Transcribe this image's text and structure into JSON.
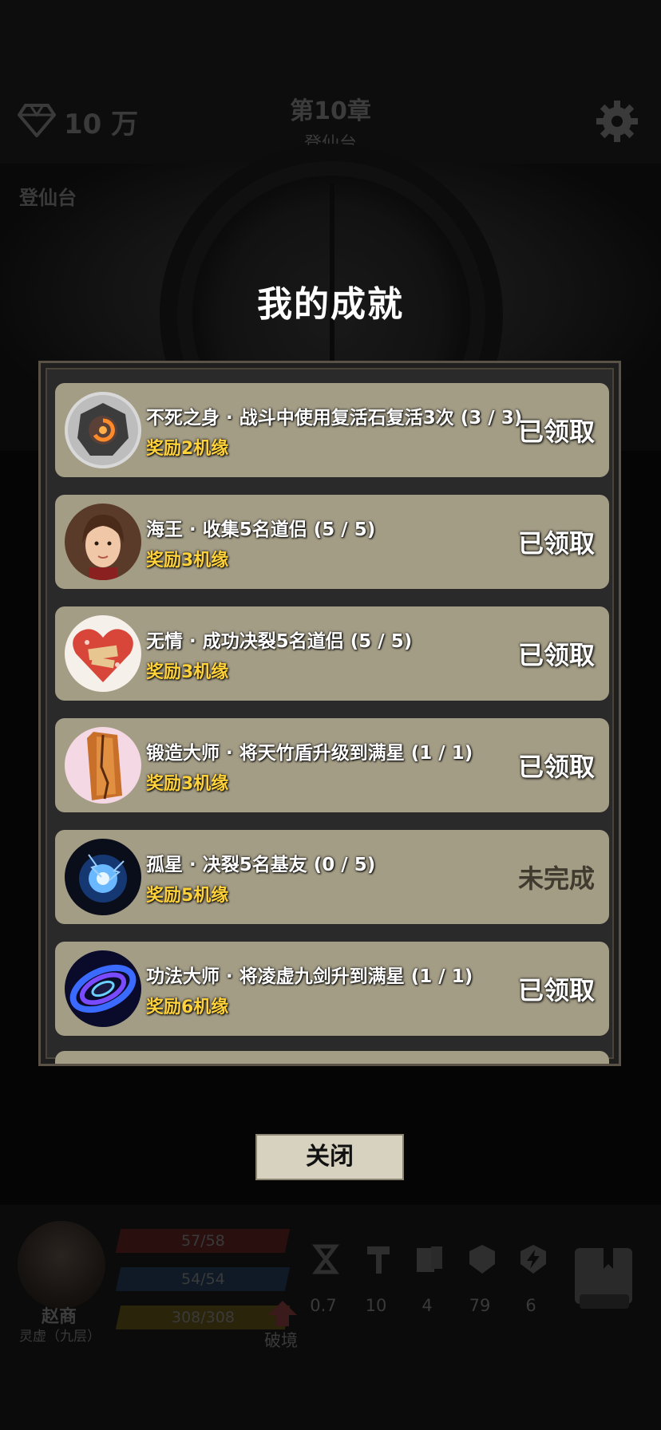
{
  "header": {
    "currency_amount": "10 万",
    "chapter": "第10章",
    "chapter_subtitle": "登仙台",
    "scene_label": "登仙台"
  },
  "modal": {
    "title": "我的成就",
    "close_label": "关闭",
    "achievements": [
      {
        "title": "不死之身 · 战斗中使用复活石复活3次 (3 / 3)",
        "reward": "奖励2机缘",
        "status": "已领取",
        "icon": "revive-stone-icon"
      },
      {
        "title": "海王 · 收集5名道侣 (5 / 5)",
        "reward": "奖励3机缘",
        "status": "已领取",
        "icon": "companion-portrait-icon"
      },
      {
        "title": "无情 · 成功决裂5名道侣 (5 / 5)",
        "reward": "奖励3机缘",
        "status": "已领取",
        "icon": "broken-heart-icon"
      },
      {
        "title": "锻造大师 · 将天竹盾升级到满星 (1 / 1)",
        "reward": "奖励3机缘",
        "status": "已领取",
        "icon": "bamboo-shield-icon"
      },
      {
        "title": "孤星 · 决裂5名基友 (0 / 5)",
        "reward": "奖励5机缘",
        "status": "未完成",
        "icon": "lone-star-orb-icon"
      },
      {
        "title": "功法大师 · 将凌虚九剑升到满星 (1 / 1)",
        "reward": "奖励6机缘",
        "status": "已领取",
        "icon": "vortex-skill-icon"
      }
    ]
  },
  "hud": {
    "hero_name": "赵商",
    "hero_realm": "灵虚（九层）",
    "hp": "57/58",
    "mp": "54/54",
    "exp": "308/308",
    "breakthrough_label": "破境",
    "stats": [
      "0.7",
      "10",
      "4",
      "79",
      "6"
    ]
  },
  "colors": {
    "card_bg": "#a49d86",
    "reward_text": "#ffd23a",
    "panel_border": "#5a5246"
  }
}
